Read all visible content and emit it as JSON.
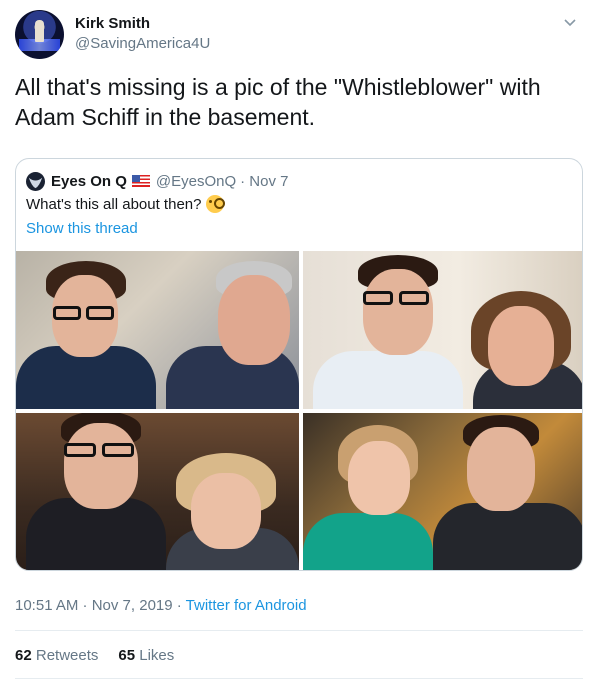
{
  "tweet": {
    "author_name": "Kirk Smith",
    "author_handle": "@SavingAmerica4U",
    "text": "All that's missing is a pic of the \"Whistleblower\" with Adam Schiff in the basement.",
    "timestamp": "10:51 AM · Nov 7, 2019",
    "separator": " · ",
    "source": "Twitter for Android",
    "retweets_count": "62",
    "retweets_label": "Retweets",
    "likes_count": "65",
    "likes_label": "Likes",
    "menu_icon": "chevron-down-icon"
  },
  "quoted_tweet": {
    "author_name": "Eyes On Q",
    "author_handle": "@EyesOnQ",
    "date": "· Nov 7",
    "text": "What's this all about then?",
    "emoji": "face-with-monocle",
    "show_thread": "Show this thread",
    "photos": [
      "photo-1",
      "photo-2",
      "photo-3",
      "photo-4"
    ]
  },
  "colors": {
    "link": "#1b95e0",
    "secondary_text": "#657786",
    "border": "#ccd6dd"
  }
}
